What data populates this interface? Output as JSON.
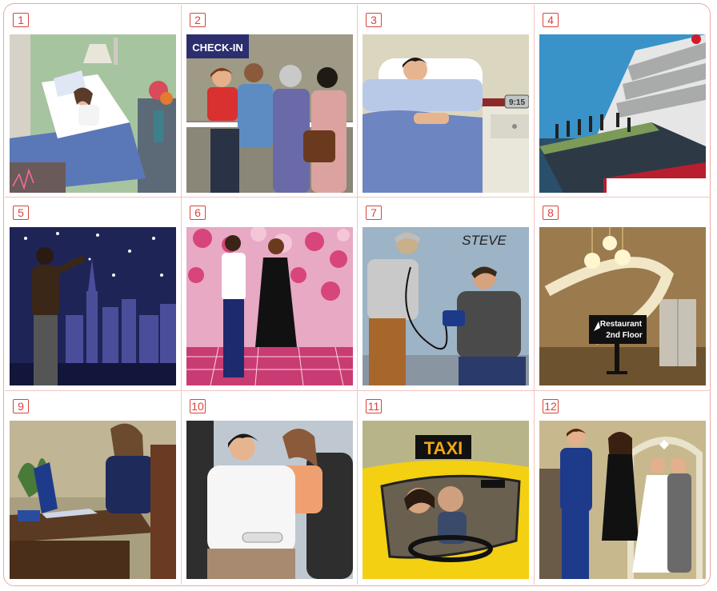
{
  "panels": [
    {
      "number": "1"
    },
    {
      "number": "2",
      "sign": "CHECK-IN"
    },
    {
      "number": "3",
      "clock": "9:15"
    },
    {
      "number": "4"
    },
    {
      "number": "5"
    },
    {
      "number": "6"
    },
    {
      "number": "7",
      "name": "STEVE"
    },
    {
      "number": "8",
      "sign_line1": "Restaurant",
      "sign_line2": "2nd Floor"
    },
    {
      "number": "9"
    },
    {
      "number": "10"
    },
    {
      "number": "11",
      "sign": "TAXI"
    },
    {
      "number": "12"
    }
  ],
  "colors": {
    "frame": "#f0a6a6",
    "number_badge": "#d9443c"
  }
}
